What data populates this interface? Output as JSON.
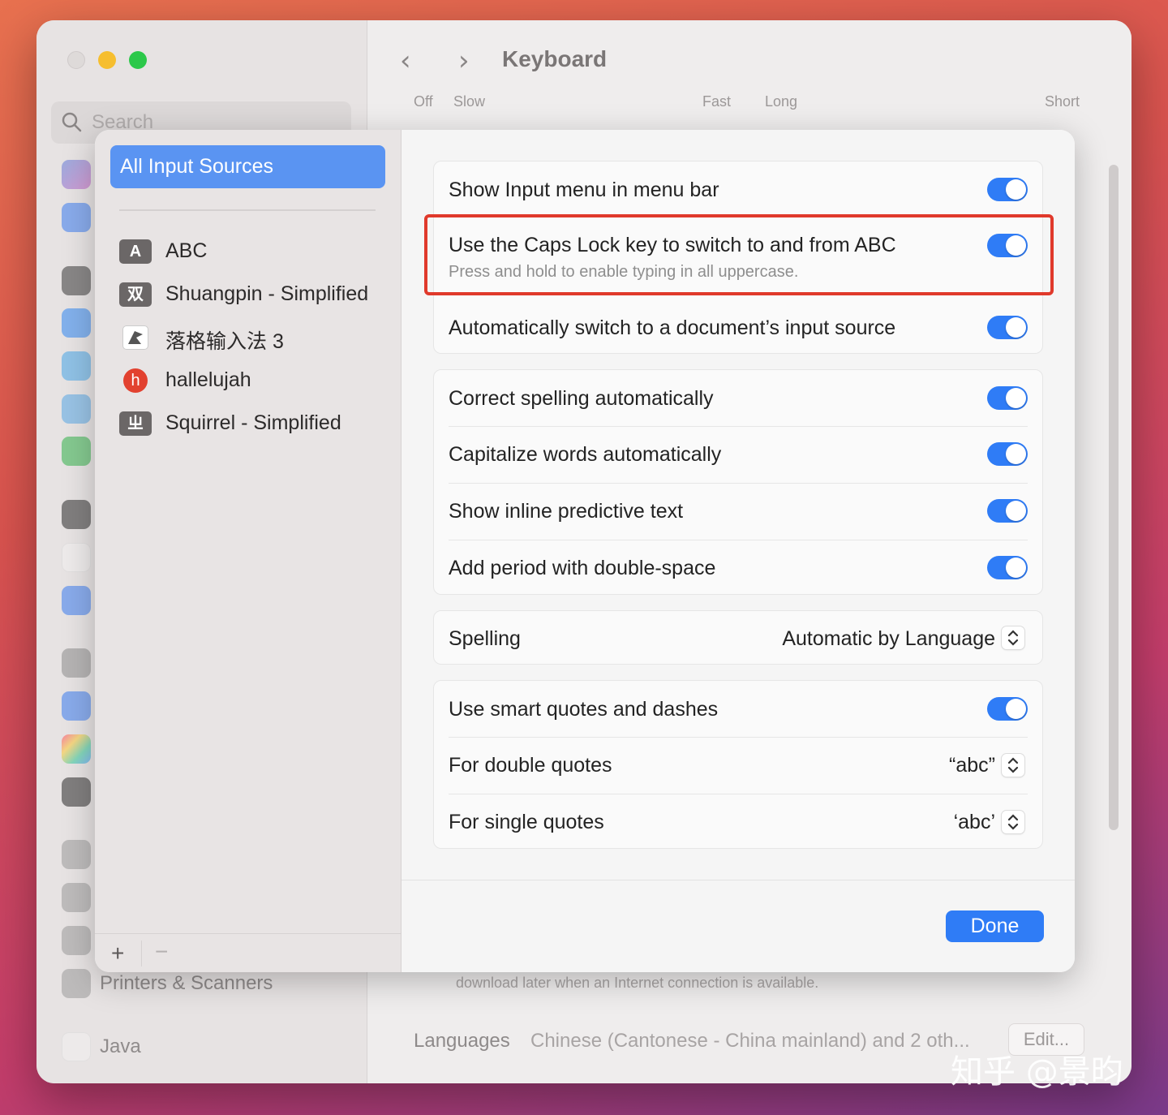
{
  "window": {
    "title": "Keyboard",
    "search_placeholder": "Search",
    "slider_labels": [
      "Off",
      "Slow",
      "Fast",
      "Long",
      "Short"
    ],
    "sidebar_bottom": [
      "Printers & Scanners",
      "Java"
    ],
    "bg_note": "download later when an Internet connection is available.",
    "languages_label": "Languages",
    "languages_value": "Chinese (Cantonese - China mainland) and 2 oth...",
    "edit_label": "Edit..."
  },
  "sheet": {
    "all_sources_label": "All Input Sources",
    "sources": [
      {
        "icon_text": "A",
        "label": "ABC"
      },
      {
        "icon_text": "双",
        "label": "Shuangpin - Simplified"
      },
      {
        "icon_text": "",
        "label": "落格输入法 3"
      },
      {
        "icon_text": "h",
        "label": "hallelujah"
      },
      {
        "icon_text": "ㄓ",
        "label": "Squirrel - Simplified"
      }
    ],
    "add_label": "+",
    "remove_label": "−",
    "settings": {
      "show_input_menu": "Show Input menu in menu bar",
      "caps_lock": "Use the Caps Lock key to switch to and from ABC",
      "caps_lock_sub": "Press and hold to enable typing in all uppercase.",
      "auto_switch": "Automatically switch to a document’s input source",
      "correct_spelling": "Correct spelling automatically",
      "capitalize": "Capitalize words automatically",
      "predictive": "Show inline predictive text",
      "period": "Add period with double-space",
      "spelling_label": "Spelling",
      "spelling_value": "Automatic by Language",
      "smart_quotes": "Use smart quotes and dashes",
      "double_quotes_label": "For double quotes",
      "double_quotes_value": "“abc”",
      "single_quotes_label": "For single quotes",
      "single_quotes_value": "‘abc’"
    },
    "toggles": {
      "show_input_menu": true,
      "caps_lock": true,
      "auto_switch": true,
      "correct_spelling": true,
      "capitalize": true,
      "predictive": true,
      "period": true,
      "smart_quotes": true
    },
    "done_label": "Done"
  },
  "watermark": "知乎 @景昀",
  "colors": {
    "accent": "#2f7cf6",
    "highlight": "#e0392b",
    "selection": "#5a94f2"
  }
}
